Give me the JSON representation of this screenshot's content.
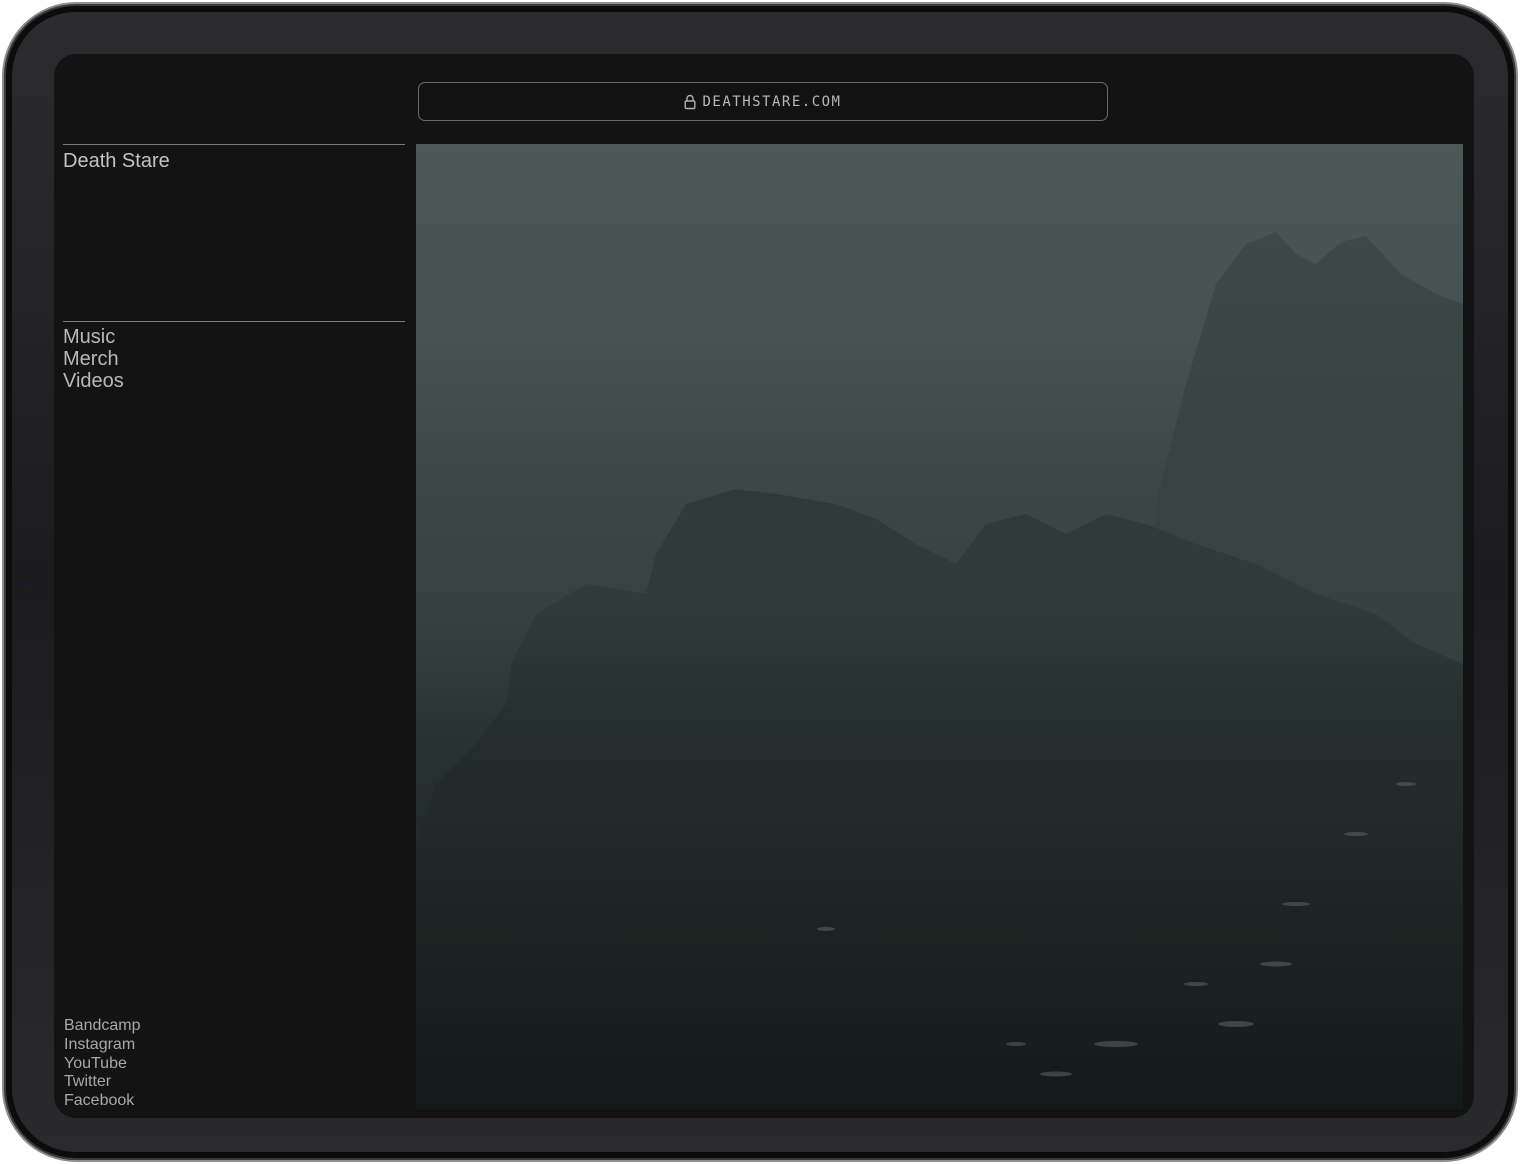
{
  "browser": {
    "url": "DEATHSTARE.COM",
    "lock_icon": "lock-icon"
  },
  "site": {
    "title": "Death Stare"
  },
  "nav": {
    "items": [
      {
        "label": "Music"
      },
      {
        "label": "Merch"
      },
      {
        "label": "Videos"
      }
    ]
  },
  "social": {
    "items": [
      {
        "label": "Bandcamp"
      },
      {
        "label": "Instagram"
      },
      {
        "label": "YouTube"
      },
      {
        "label": "Twitter"
      },
      {
        "label": "Facebook"
      }
    ]
  },
  "colors": {
    "background": "#131313",
    "text": "#c4c4c4",
    "rule": "#7a7a7a",
    "hero_top": "#4c5756",
    "hero_bottom": "#151c1b"
  }
}
